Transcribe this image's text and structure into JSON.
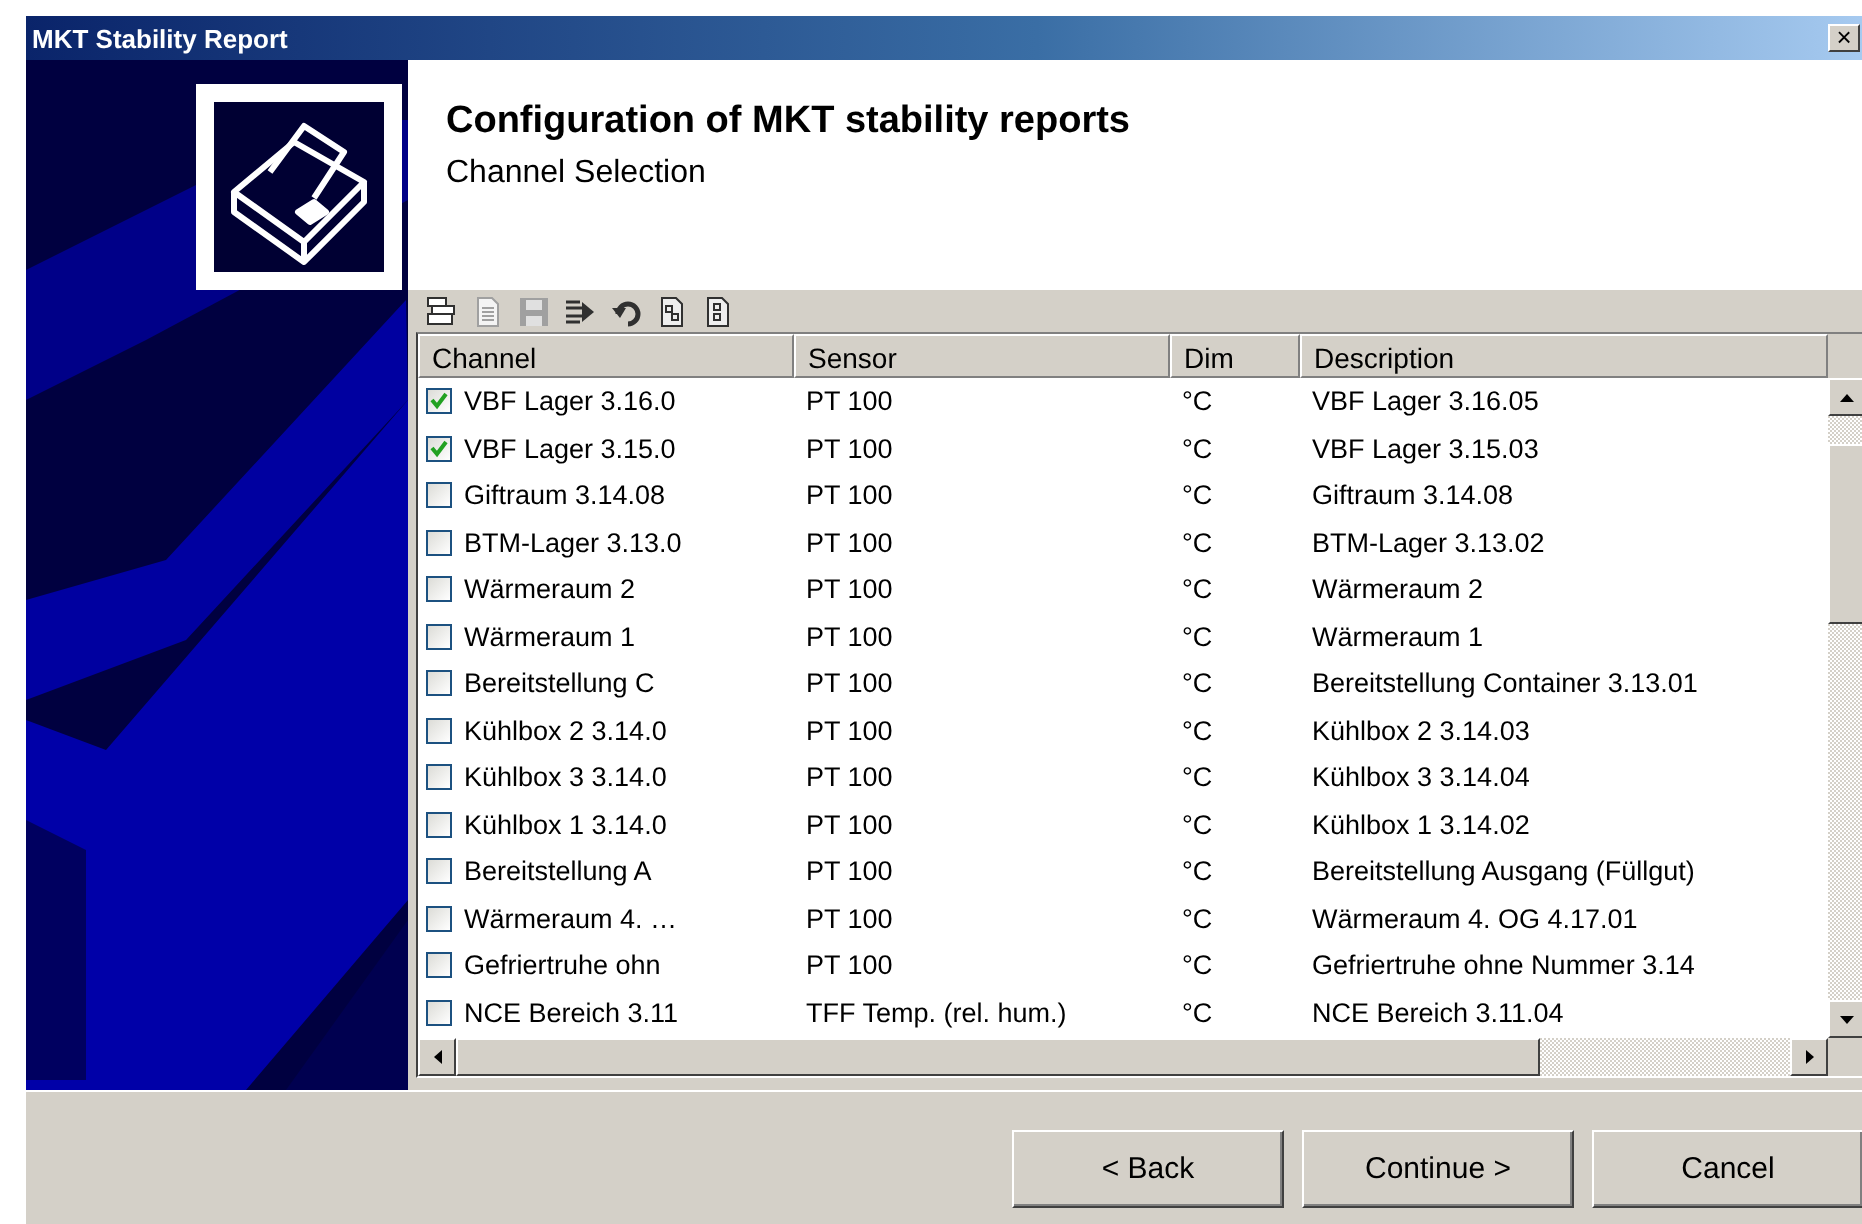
{
  "window": {
    "title": "MKT Stability Report",
    "close": "×"
  },
  "header": {
    "title": "Configuration of MKT stability reports",
    "subtitle": "Channel Selection"
  },
  "toolbar": [
    {
      "kind": "columns",
      "disabled": false
    },
    {
      "kind": "page",
      "disabled": true
    },
    {
      "kind": "save",
      "disabled": true
    },
    {
      "kind": "forward",
      "disabled": false
    },
    {
      "kind": "undo",
      "disabled": false
    },
    {
      "kind": "export",
      "disabled": false
    },
    {
      "kind": "import",
      "disabled": false
    }
  ],
  "table": {
    "columns": [
      "Channel",
      "Sensor",
      "Dim",
      "Description"
    ],
    "rows": [
      {
        "checked": true,
        "channel": "VBF Lager 3.16.0",
        "sensor": "PT 100",
        "dim": "°C",
        "description": "VBF Lager 3.16.05"
      },
      {
        "checked": true,
        "channel": "VBF Lager 3.15.0",
        "sensor": "PT 100",
        "dim": "°C",
        "description": "VBF Lager 3.15.03"
      },
      {
        "checked": false,
        "channel": "Giftraum 3.14.08",
        "sensor": "PT 100",
        "dim": "°C",
        "description": "Giftraum 3.14.08"
      },
      {
        "checked": false,
        "channel": "BTM-Lager 3.13.0",
        "sensor": "PT 100",
        "dim": "°C",
        "description": "BTM-Lager 3.13.02"
      },
      {
        "checked": false,
        "channel": "Wärmeraum 2",
        "sensor": "PT 100",
        "dim": "°C",
        "description": "Wärmeraum 2"
      },
      {
        "checked": false,
        "channel": "Wärmeraum 1",
        "sensor": "PT 100",
        "dim": "°C",
        "description": "Wärmeraum 1"
      },
      {
        "checked": false,
        "channel": "Bereitstellung C",
        "sensor": "PT 100",
        "dim": "°C",
        "description": "Bereitstellung Container 3.13.01"
      },
      {
        "checked": false,
        "channel": "Kühlbox 2 3.14.0",
        "sensor": "PT 100",
        "dim": "°C",
        "description": "Kühlbox 2 3.14.03"
      },
      {
        "checked": false,
        "channel": "Kühlbox 3 3.14.0",
        "sensor": "PT 100",
        "dim": "°C",
        "description": "Kühlbox 3 3.14.04"
      },
      {
        "checked": false,
        "channel": "Kühlbox 1 3.14.0",
        "sensor": "PT 100",
        "dim": "°C",
        "description": "Kühlbox 1 3.14.02"
      },
      {
        "checked": false,
        "channel": "Bereitstellung A",
        "sensor": "PT 100",
        "dim": "°C",
        "description": "Bereitstellung Ausgang (Füllgut)"
      },
      {
        "checked": false,
        "channel": "Wärmeraum 4. …",
        "sensor": "PT 100",
        "dim": "°C",
        "description": "Wärmeraum 4. OG 4.17.01"
      },
      {
        "checked": false,
        "channel": "Gefriertruhe ohn",
        "sensor": "PT 100",
        "dim": "°C",
        "description": "Gefriertruhe ohne Nummer 3.14"
      },
      {
        "checked": false,
        "channel": "NCE Bereich 3.11",
        "sensor": "TFF Temp. (rel. hum.)",
        "dim": "°C",
        "description": "NCE Bereich 3.11.04"
      }
    ]
  },
  "buttons": [
    "< Back",
    "Continue >",
    "Cancel"
  ]
}
